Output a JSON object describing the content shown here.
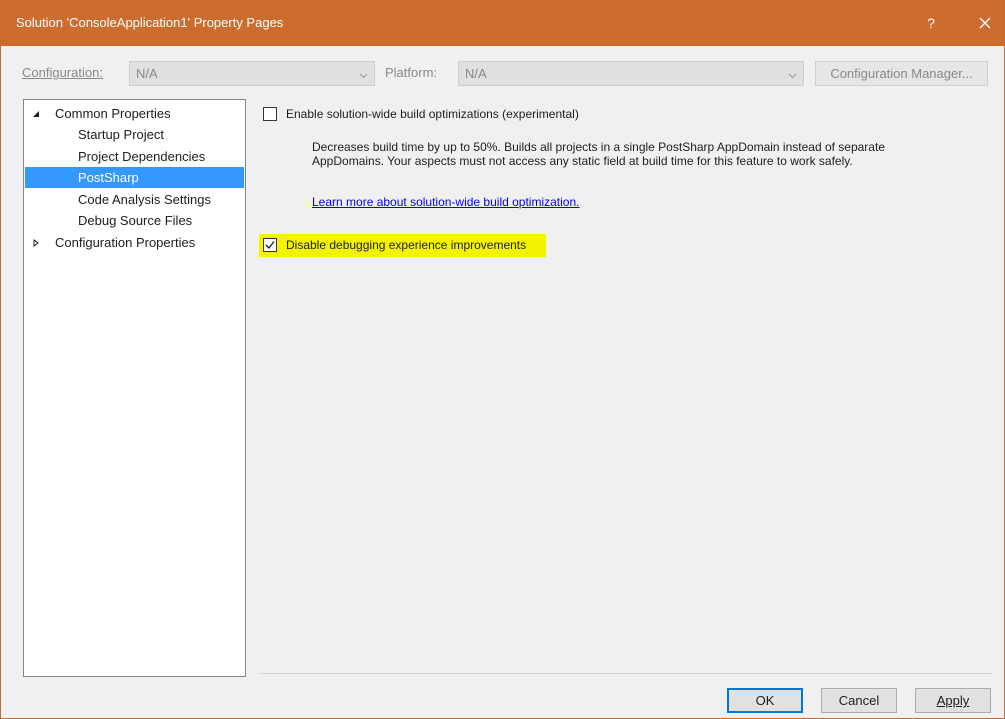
{
  "window": {
    "title": "Solution 'ConsoleApplication1' Property Pages",
    "help_glyph": "?",
    "close_glyph": "✕",
    "accent_color": "#cc6d2f"
  },
  "toolbar": {
    "configuration_label": "Configuration:",
    "configuration_value": "N/A",
    "platform_label": "Platform:",
    "platform_value": "N/A",
    "config_manager_label": "Configuration Manager..."
  },
  "tree": {
    "items": [
      {
        "label": "Common Properties",
        "expanded": true
      },
      {
        "label": "Startup Project"
      },
      {
        "label": "Project Dependencies"
      },
      {
        "label": "PostSharp",
        "selected": true
      },
      {
        "label": "Code Analysis Settings"
      },
      {
        "label": "Debug Source Files"
      },
      {
        "label": "Configuration Properties",
        "expanded": false
      }
    ],
    "selection_color": "#3399ff"
  },
  "content": {
    "option1_label": "Enable solution-wide build optimizations (experimental)",
    "option1_checked": false,
    "option1_description": "Decreases build time by up to 50%. Builds all projects in a single PostSharp AppDomain instead of separate AppDomains. Your aspects must not access any static field at build time for this feature to work safely.",
    "learn_more_link": "Learn more about solution-wide build optimization.",
    "option2_label": "Disable debugging experience improvements",
    "option2_checked": true,
    "highlight_color": "#f3f300"
  },
  "buttons": {
    "ok": "OK",
    "cancel": "Cancel",
    "apply": "Apply"
  }
}
